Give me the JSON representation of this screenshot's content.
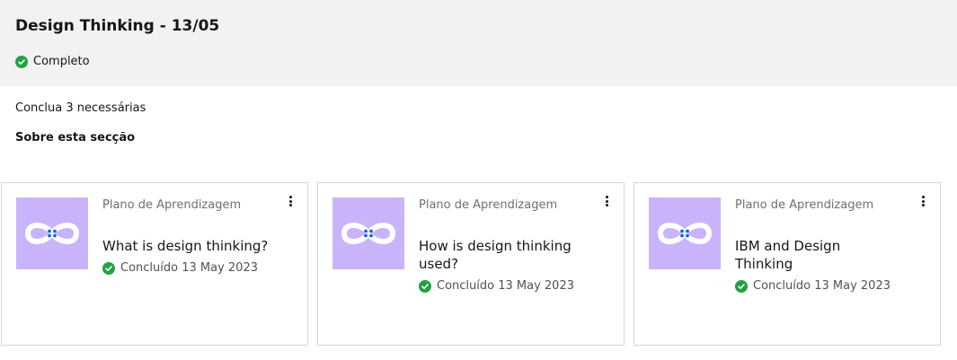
{
  "section": {
    "title": "Design Thinking - 13/05",
    "status": "Completo",
    "required_text": "Conclua 3 necessárias",
    "about_link": "Sobre esta secção"
  },
  "cards": [
    {
      "type_label": "Plano de Aprendizagem",
      "title": "What is design thinking?",
      "completion": "Concluído 13 May 2023"
    },
    {
      "type_label": "Plano de Aprendizagem",
      "title": "How is design thinking used?",
      "completion": "Concluído 13 May 2023"
    },
    {
      "type_label": "Plano de Aprendizagem",
      "title": "IBM and Design Thinking",
      "completion": "Concluído 13 May 2023"
    }
  ],
  "icons": {
    "status": "check-circle-icon",
    "card_menu": "overflow-menu-vertical-icon",
    "thumbnail": "infinity-loop-icon"
  },
  "colors": {
    "success": "#24a148",
    "thumbnail_bg": "#c9b4fb",
    "header_bg": "#f2f2f2"
  }
}
